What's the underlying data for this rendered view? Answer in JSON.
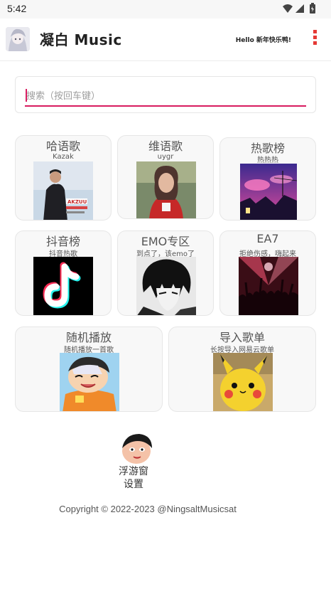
{
  "status_bar": {
    "time": "5:42",
    "icons": [
      "wifi-icon",
      "signal-icon",
      "battery-icon"
    ]
  },
  "app_bar": {
    "title": "凝白 Music",
    "greeting": "Hello 新年快乐鸭!",
    "menu_icon": "more-vert-icon"
  },
  "search": {
    "placeholder": "搜索（按回车键）"
  },
  "cards": [
    {
      "title": "哈语歌",
      "subtitle": "Kazak"
    },
    {
      "title": "维语歌",
      "subtitle": "uygr"
    },
    {
      "title": "热歌榜",
      "subtitle": "热热热"
    },
    {
      "title": "抖音榜",
      "subtitle": "抖音热歌"
    },
    {
      "title": "EMO专区",
      "subtitle": "到点了，该emo了"
    },
    {
      "title": "EA7",
      "subtitle": "拒绝伤感，嗨起来"
    },
    {
      "title": "随机播放",
      "subtitle": "随机播放一首歌"
    },
    {
      "title": "导入歌单",
      "subtitle": "长按导入网易云歌单"
    }
  ],
  "album_art_text": {
    "kazak_cover": "AKZUU"
  },
  "floating_window": {
    "line1": "浮游窗",
    "line2": "设置"
  },
  "footer": {
    "copyright": "Copyright © 2022-2023 @NingsaltMusicsat"
  },
  "colors": {
    "accent": "#d81b60",
    "menu_dots": "#e53935",
    "card_bg": "#f8f8f8"
  }
}
